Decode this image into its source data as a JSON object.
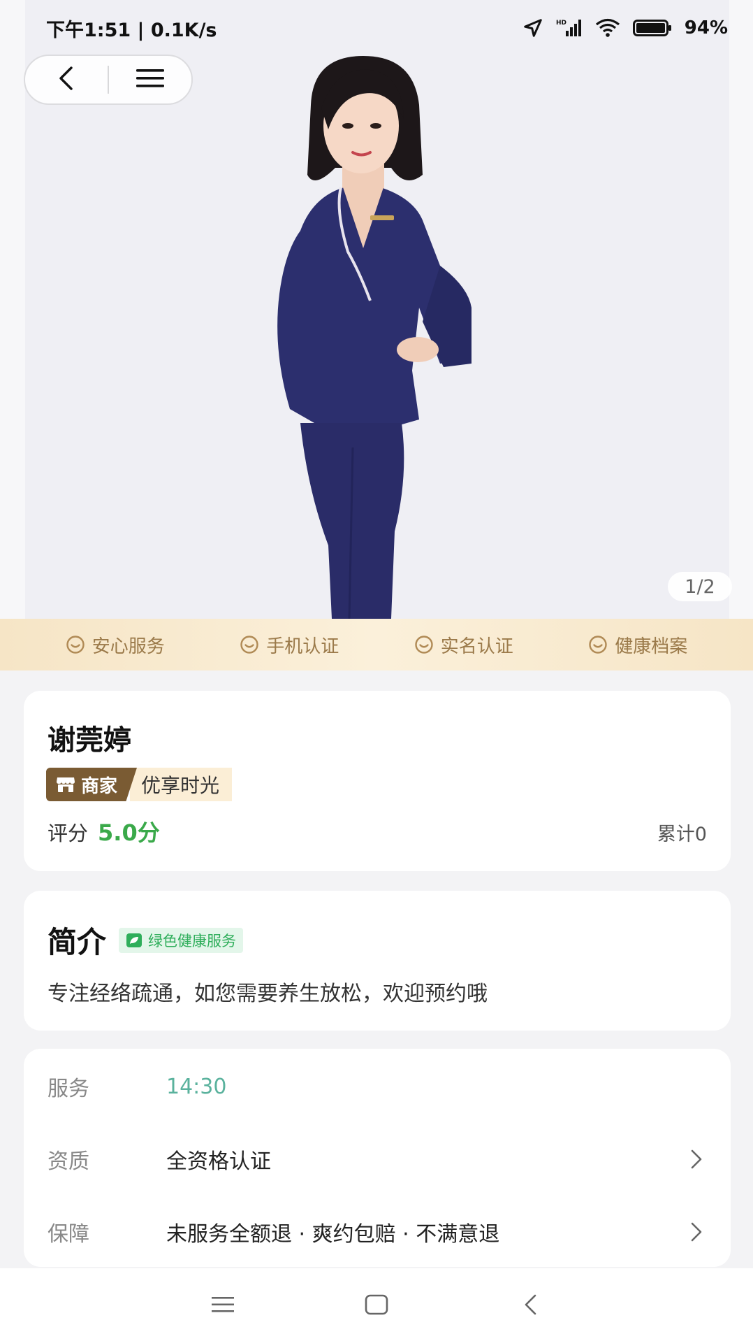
{
  "status_bar": {
    "time": "下午1:51 | 0.1K/s",
    "battery": "94%",
    "icons": [
      "location-icon",
      "signal-icon",
      "wifi-icon",
      "battery-icon"
    ]
  },
  "nav": {
    "icons": [
      "back-icon",
      "menu-icon"
    ]
  },
  "gallery": {
    "pager": "1/2"
  },
  "guarantees": [
    "安心服务",
    "手机认证",
    "实名认证",
    "健康档案"
  ],
  "profile": {
    "name": "谢莞婷",
    "merchant_tag": "商家",
    "shop_name": "优享时光",
    "rating_label": "评分",
    "rating_value": "5.0分",
    "total": "累计0"
  },
  "intro": {
    "title": "简介",
    "badge": "绿色健康服务",
    "text": "专注经络疏通，如您需要养生放松，欢迎预约哦"
  },
  "details": [
    {
      "label": "服务",
      "value": "14:30"
    },
    {
      "label": "资质",
      "value": "全资格认证"
    },
    {
      "label": "保障",
      "value": "未服务全额退 · 爽约包赔 · 不满意退"
    }
  ],
  "colors": {
    "accent_green": "#3aa94a",
    "time_green": "#5ab29d",
    "gold_text": "#9b7a4a",
    "merchant_brown": "#7a5b33",
    "uniform_navy": "#2c2f6e"
  }
}
